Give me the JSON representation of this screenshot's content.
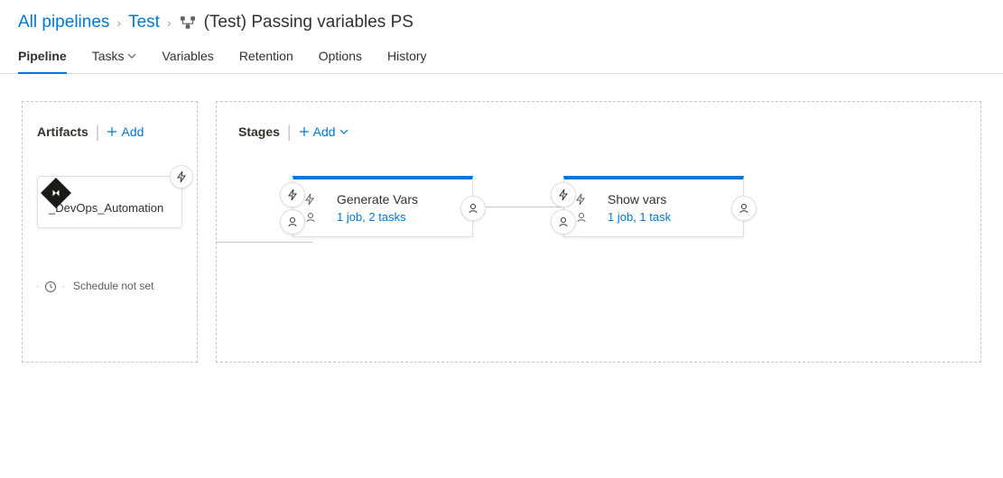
{
  "breadcrumb": {
    "root": "All pipelines",
    "parent": "Test",
    "current": "(Test) Passing variables PS"
  },
  "tabs": {
    "pipeline": "Pipeline",
    "tasks": "Tasks",
    "variables": "Variables",
    "retention": "Retention",
    "options": "Options",
    "history": "History"
  },
  "artifacts": {
    "title": "Artifacts",
    "add_label": "Add",
    "item_name": "_DevOps_Automation",
    "schedule_label": "Schedule not set"
  },
  "stages": {
    "title": "Stages",
    "add_label": "Add",
    "items": [
      {
        "name": "Generate Vars",
        "meta": "1 job, 2 tasks"
      },
      {
        "name": "Show vars",
        "meta": "1 job, 1 task"
      }
    ]
  }
}
